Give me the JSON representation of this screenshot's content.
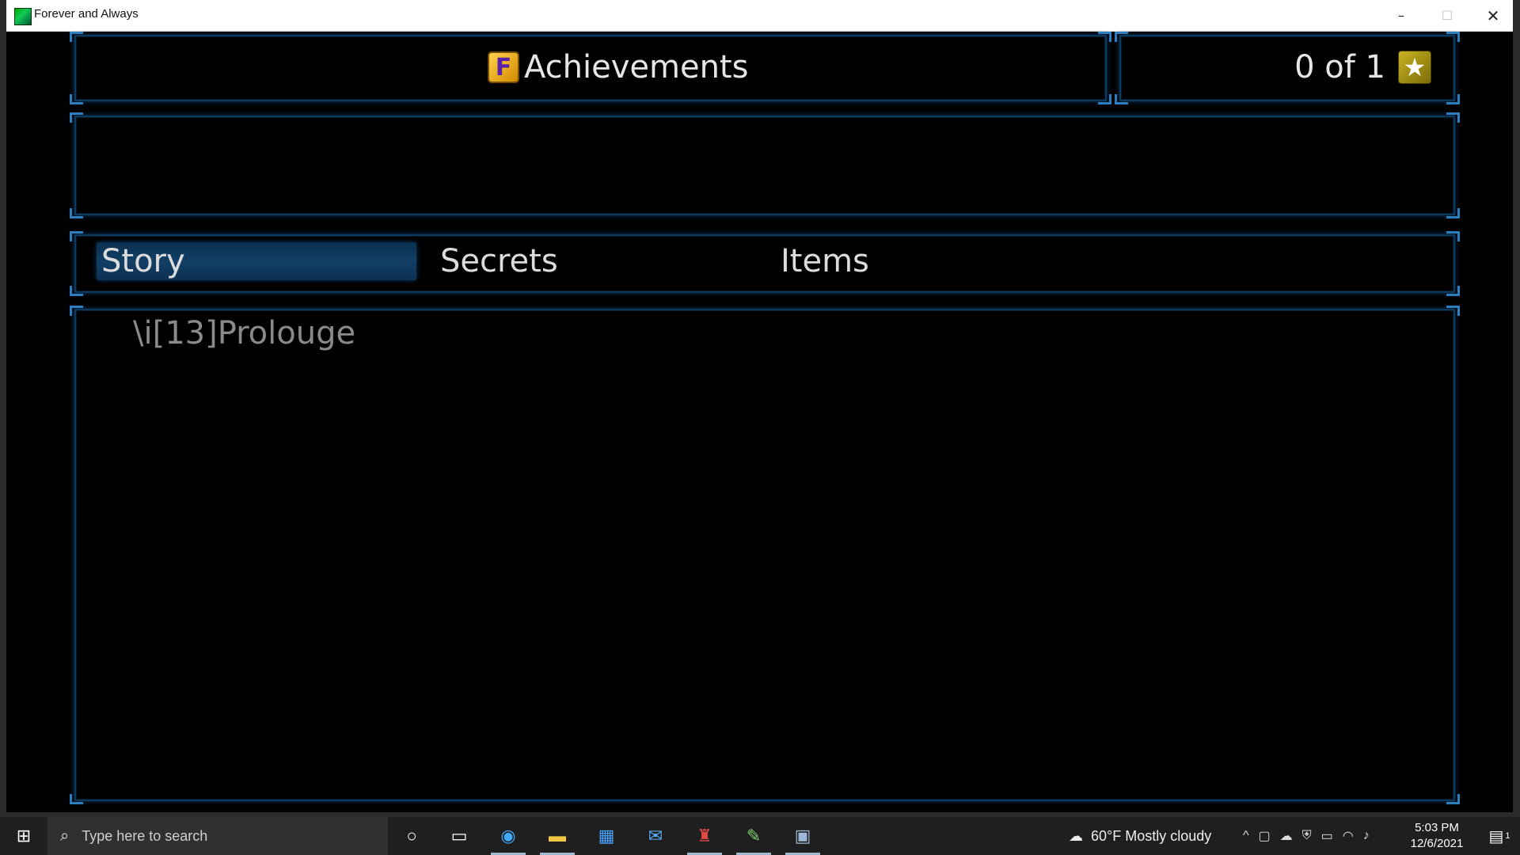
{
  "window": {
    "title": "Forever and Always",
    "controls": {
      "minimize": "–",
      "maximize": "☐",
      "close": "✕"
    }
  },
  "header": {
    "badge_letter": "F",
    "title": "Achievements",
    "count_text": "0 of 1",
    "count_icon": "★"
  },
  "tabs": [
    {
      "label": "Story",
      "active": true
    },
    {
      "label": "Secrets",
      "active": false
    },
    {
      "label": "Items",
      "active": false
    }
  ],
  "list": {
    "items": [
      {
        "label": "\\i[13]Prolouge"
      }
    ]
  },
  "taskbar": {
    "search_placeholder": "Type here to search",
    "weather": "60°F  Mostly cloudy",
    "time": "5:03 PM",
    "date": "12/6/2021",
    "notification_count": "1",
    "icons": [
      "cortana-icon",
      "task-view-icon",
      "edge-icon",
      "file-explorer-icon",
      "store-icon",
      "mail-icon",
      "game-icon",
      "editor-icon",
      "running-app-icon"
    ]
  },
  "colors": {
    "frame_border": "#0c3a5e",
    "frame_corner": "#2b7fc0",
    "tab_highlight": "#123f66",
    "text_primary": "#e6e6e6",
    "text_muted": "#8a8a8a",
    "badge_gold": "#ffd24a"
  }
}
